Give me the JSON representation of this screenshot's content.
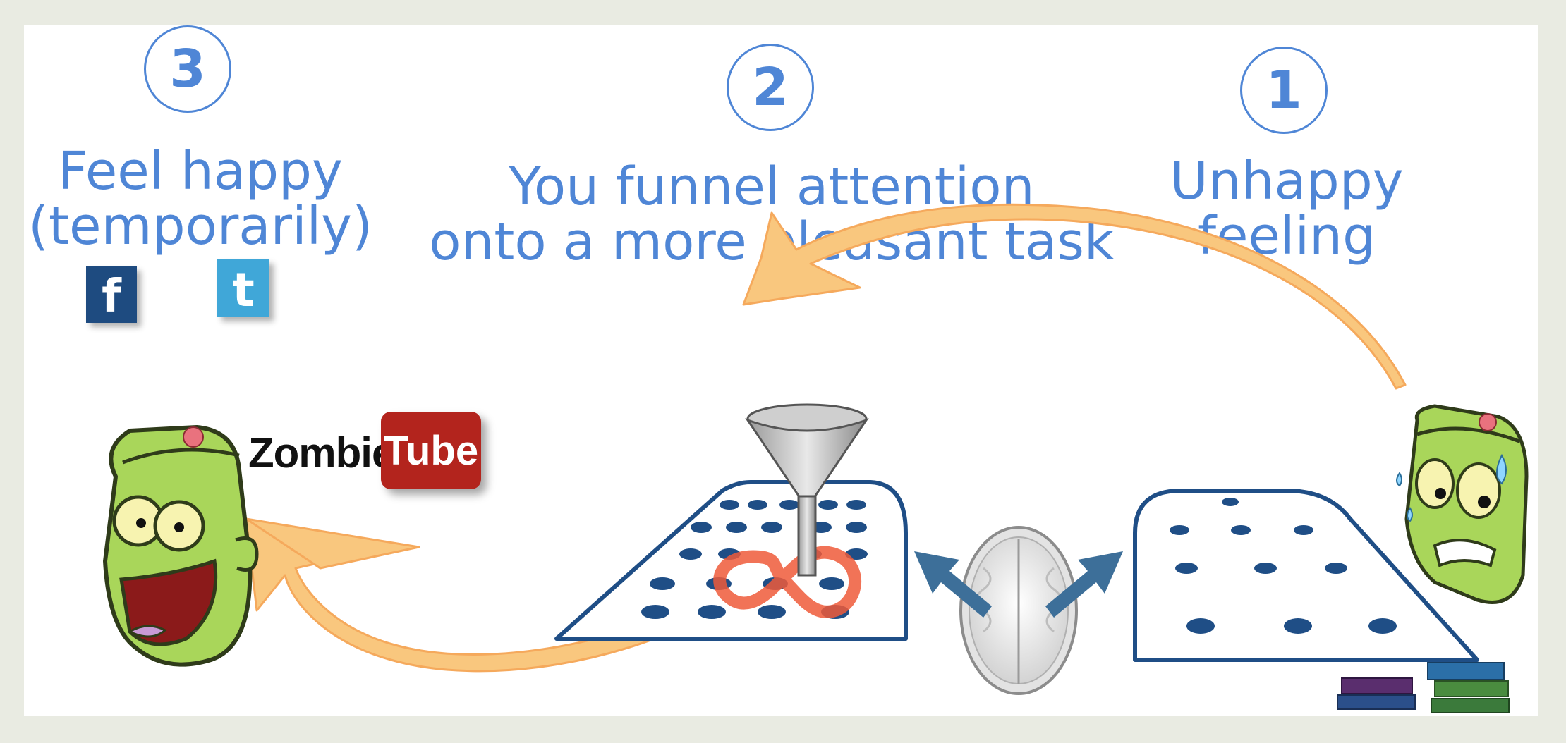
{
  "steps": [
    {
      "number": "3",
      "line1": "Feel happy",
      "line2": "(temporarily)"
    },
    {
      "number": "2",
      "line1": "You funnel attention",
      "line2": "onto a more pleasant task"
    },
    {
      "number": "1",
      "line1": "Unhappy",
      "line2": "feeling"
    }
  ],
  "logos": {
    "facebook_letter": "f",
    "twitter_letter": "t",
    "brand_part1": "Zombie",
    "brand_part2": "Tube"
  },
  "colors": {
    "title_blue": "#4f86d6",
    "arrow_orange": "#f9c77e",
    "board_navy": "#1f4e86",
    "zombie_green": "#a9d65a",
    "tube_red": "#b3241d"
  }
}
